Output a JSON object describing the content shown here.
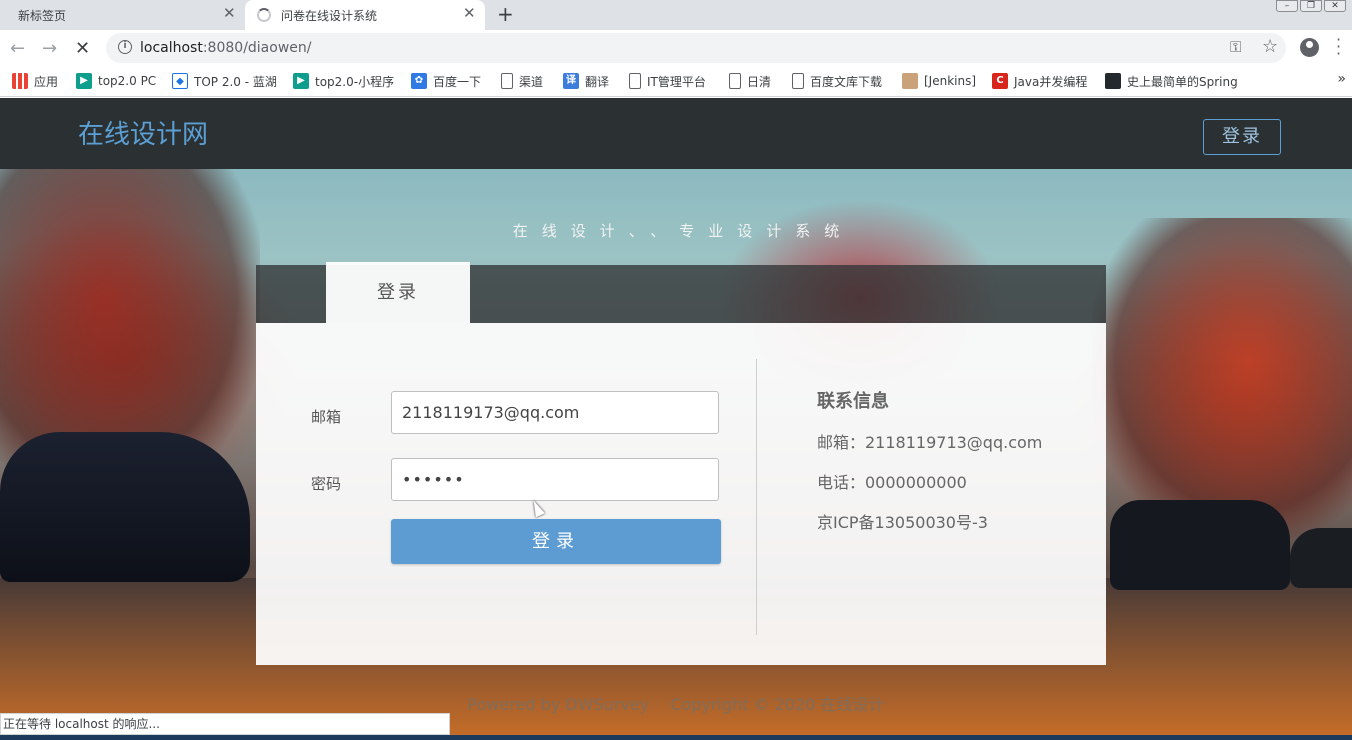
{
  "browser": {
    "tabs": [
      {
        "title": "新标签页",
        "active": false
      },
      {
        "title": "问卷在线设计系统",
        "active": true,
        "loading": true
      }
    ],
    "url_host": "localhost",
    "url_path": ":8080/diaowen/",
    "bookmarks": [
      {
        "label": "应用",
        "icon": "apps-grid-icon"
      },
      {
        "label": "top2.0 PC",
        "icon": "play-icon"
      },
      {
        "label": "TOP 2.0 - 蓝湖",
        "icon": "lanhu-icon"
      },
      {
        "label": "top2.0-小程序",
        "icon": "play-icon"
      },
      {
        "label": "百度一下",
        "icon": "baidu-paw-icon"
      },
      {
        "label": "渠道",
        "icon": "document-icon"
      },
      {
        "label": "翻译",
        "icon": "translate-icon"
      },
      {
        "label": "IT管理平台",
        "icon": "document-icon"
      },
      {
        "label": "日清",
        "icon": "document-icon"
      },
      {
        "label": "百度文库下载",
        "icon": "document-icon"
      },
      {
        "label": "[Jenkins]",
        "icon": "jenkins-icon"
      },
      {
        "label": "Java并发编程",
        "icon": "csdn-icon"
      },
      {
        "label": "史上最简单的Spring",
        "icon": "github-icon"
      }
    ],
    "status_text": "正在等待 localhost 的响应..."
  },
  "site": {
    "logo": "在线设计网",
    "header_login": "登录",
    "slogan": "在线设计、、专业设计系统",
    "login_tab": "登录",
    "email_label": "邮箱",
    "email_value": "2118119173@qq.com",
    "password_label": "密码",
    "password_value": "••••••",
    "login_button": "登录",
    "contact": {
      "title": "联系信息",
      "email": "邮箱：2118119713@qq.com",
      "phone": "电话：0000000000",
      "icp": "京ICP备13050030号-3"
    },
    "footer_powered": "Powered by DWSurvey",
    "footer_copyright": "Copyright © 2020 在线设计"
  },
  "colors": {
    "accent": "#5d9bd3",
    "header_bg": "#282c2e",
    "logo": "#5b9fd4"
  }
}
